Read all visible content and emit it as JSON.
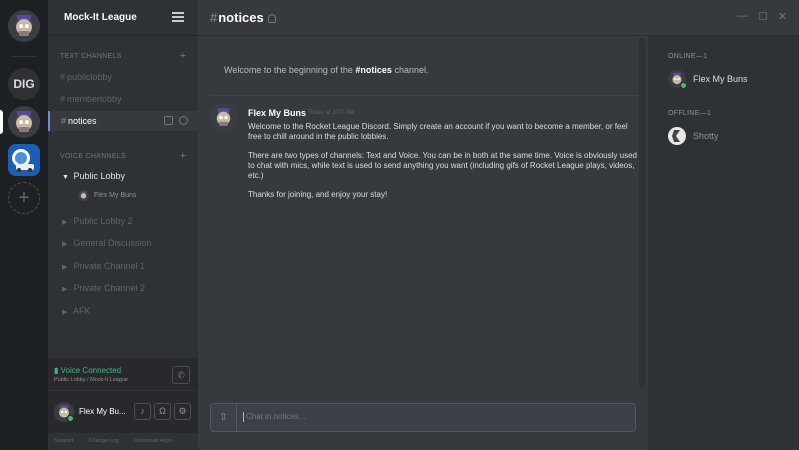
{
  "app": {
    "accent": "#7289da",
    "online_color": "#43b581"
  },
  "guild": {
    "name": "Mock-It League"
  },
  "rail": {
    "servers": [
      {
        "label": "DIG"
      }
    ],
    "add_label": "+"
  },
  "sidebar": {
    "text_category": "TEXT CHANNELS",
    "text_channels": [
      {
        "name": "publiclobby"
      },
      {
        "name": "memberlobby"
      },
      {
        "name": "notices"
      }
    ],
    "voice_category": "VOICE CHANNELS",
    "voice_channels": [
      {
        "name": "Public Lobby"
      },
      {
        "name": "Public Lobby 2"
      },
      {
        "name": "General Discussion"
      },
      {
        "name": "Private Channel 1"
      },
      {
        "name": "Private Channel 2"
      },
      {
        "name": "AFK"
      }
    ],
    "voice_member": "Flex My Buns"
  },
  "voicebar": {
    "status": "Voice Connected",
    "location": "Public Lobby / Mock-It League"
  },
  "userbar": {
    "name": "Flex My Bu..."
  },
  "footer": {
    "links": [
      "Support",
      "Change Log",
      "Download Apps"
    ]
  },
  "channel": {
    "hash": "#",
    "name": "notices"
  },
  "welcome": {
    "prefix": "Welcome to the beginning of the ",
    "channel": "#notices",
    "suffix": " channel."
  },
  "message": {
    "author": "Flex My Buns",
    "timestamp": "Today at 1:07 AM",
    "paragraphs": [
      "Welcome to the Rocket League Discord. Simply create an account if you want to become a member, or feel free to chill around in the public lobbies.",
      "There are two types of channels: Text and Voice. You can be in both at the same time. Voice is obviously used to chat with mics, while text is used to send anything you want (including gifs of Rocket League plays, videos, etc.)",
      "Thanks for joining, and enjoy your stay!"
    ]
  },
  "composer": {
    "placeholder": "Chat in notices..."
  },
  "members": {
    "online_label": "ONLINE—1",
    "online": [
      {
        "name": "Flex My Buns"
      }
    ],
    "offline_label": "OFFLINE—1",
    "offline": [
      {
        "name": "Shotty"
      }
    ]
  }
}
